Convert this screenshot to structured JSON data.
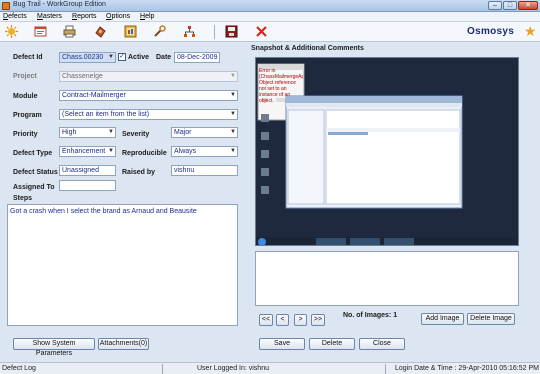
{
  "window": {
    "title": "Bug Trail - WorkGroup Edition",
    "minimize": "–",
    "maximize": "□",
    "close": "✕"
  },
  "menu": {
    "items": [
      {
        "label": "Defects",
        "u": "D",
        "rest": "efects"
      },
      {
        "label": "Masters",
        "u": "M",
        "rest": "asters"
      },
      {
        "label": "Reports",
        "u": "R",
        "rest": "eports"
      },
      {
        "label": "Options",
        "u": "O",
        "rest": "ptions"
      },
      {
        "label": "Help",
        "u": "H",
        "rest": "elp"
      }
    ]
  },
  "toolbar": {
    "icons": [
      "new-defect-icon",
      "list-icon",
      "print-icon",
      "bug-icon",
      "report-icon",
      "tools-icon",
      "hierarchy-icon",
      "save-icon",
      "delete-icon"
    ],
    "brand": "Osmosys"
  },
  "form": {
    "defect_id_label": "Defect Id",
    "defect_id_value": "Chass.00230",
    "active_label": "Active",
    "active_checked": true,
    "date_label": "Date",
    "date_value": "08-Dec-2009",
    "project_label": "Project",
    "project_value": "Chassenelge",
    "module_label": "Module",
    "module_value": "Contract-Mailmerger",
    "program_label": "Program",
    "program_value": "(Select an item from the list)",
    "priority_label": "Priority",
    "priority_value": "High",
    "severity_label": "Severity",
    "severity_value": "Major",
    "defect_type_label": "Defect Type",
    "defect_type_value": "Enhancement",
    "reproducible_label": "Reproducible",
    "reproducible_value": "Always",
    "defect_status_label": "Defect Status",
    "defect_status_value": "Unassigned",
    "raised_by_label": "Raised by",
    "raised_by_value": "vishnu",
    "assigned_to_label": "Assigned To",
    "assigned_to_value": "",
    "steps_label": "Steps",
    "steps_value": "Got a crash when I select the brand as Arnaud and Beausite"
  },
  "snapshot": {
    "title": "Snapshot & Additional Comments",
    "error_text": "Error in {ChassMailmergeApplication}: Object reference not set to an instance of an object.",
    "nav_first": "<<",
    "nav_prev": "<",
    "nav_next": ">",
    "nav_last": ">>",
    "images_label": "No. of Images:",
    "images_count": "1",
    "add_image": "Add Image",
    "delete_image": "Delete Image"
  },
  "footer_buttons": {
    "show_system_parameters": "Show System Parameters",
    "attachments": "Attachments(0)",
    "save": "Save",
    "delete": "Delete",
    "close": "Close"
  },
  "status": {
    "left": "Defect Log",
    "user": "User Logged In: vishnu",
    "login": "Login Date & Time : 29-Apr-2010 05:16:52 PM"
  }
}
